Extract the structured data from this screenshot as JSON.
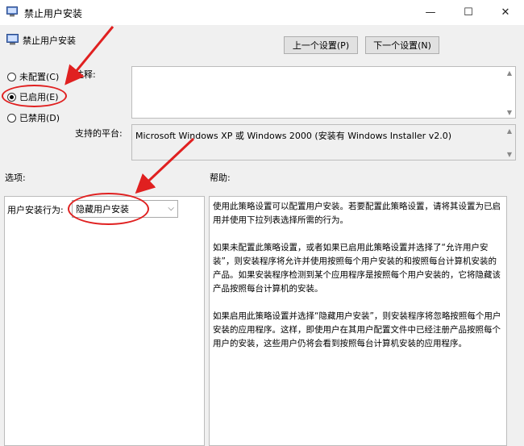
{
  "window": {
    "title": "禁止用户安装",
    "min_glyph": "—",
    "max_glyph": "☐",
    "close_glyph": "✕"
  },
  "header": {
    "policy_name": "禁止用户安装"
  },
  "nav": {
    "prev_label": "上一个设置(P)",
    "next_label": "下一个设置(N)"
  },
  "state": {
    "options": [
      {
        "label": "未配置(C)",
        "checked": false
      },
      {
        "label": "已启用(E)",
        "checked": true
      },
      {
        "label": "已禁用(D)",
        "checked": false
      }
    ]
  },
  "comment": {
    "label": "注释:",
    "value": ""
  },
  "platform": {
    "label": "支持的平台:",
    "value": "Microsoft Windows XP 或 Windows 2000 (安装有 Windows Installer v2.0)"
  },
  "sections": {
    "options_label": "选项:",
    "help_label": "帮助:"
  },
  "options_panel": {
    "field_label": "用户安装行为:",
    "selected_value": "隐藏用户安装"
  },
  "help": {
    "paragraphs": [
      "使用此策略设置可以配置用户安装。若要配置此策略设置，请将其设置为已启用并使用下拉列表选择所需的行为。",
      "如果未配置此策略设置，或者如果已启用此策略设置并选择了“允许用户安装”，则安装程序将允许并使用按照每个用户安装的和按照每台计算机安装的产品。如果安装程序检测到某个应用程序是按照每个用户安装的，它将隐藏该产品按照每台计算机的安装。",
      "如果启用此策略设置并选择“隐藏用户安装”，则安装程序将忽略按照每个用户安装的应用程序。这样，即使用户在其用户配置文件中已经注册产品按照每个用户的安装，这些用户仍将会看到按照每台计算机安装的应用程序。"
    ]
  },
  "annotation_color": "#e02020"
}
